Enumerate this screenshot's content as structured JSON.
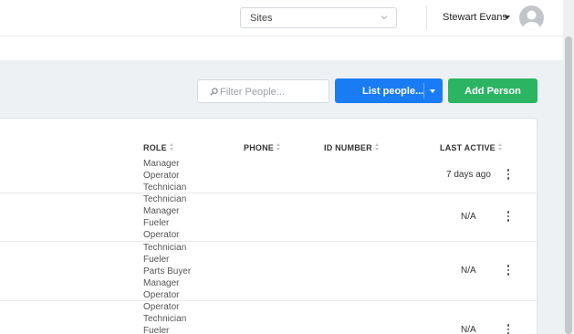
{
  "header": {
    "sites_select": {
      "value": "Sites"
    },
    "user": {
      "name": "Stewart Evans"
    }
  },
  "toolbar": {
    "filter_placeholder": "Filter People...",
    "list_people_label": "List people...",
    "add_person_label": "Add Person"
  },
  "table": {
    "columns": {
      "role": "ROLE",
      "phone": "PHONE",
      "id_number": "ID NUMBER",
      "last_active": "LAST ACTIVE"
    },
    "rows": [
      {
        "roles": [
          "Manager",
          "Operator",
          "Technician"
        ],
        "last_active": "7 days ago"
      },
      {
        "roles": [
          "Technician",
          "Manager",
          "Fueler",
          "Operator"
        ],
        "last_active": "N/A"
      },
      {
        "roles": [
          "Technician",
          "Fueler",
          "Parts Buyer",
          "Manager",
          "Operator"
        ],
        "last_active": "N/A"
      },
      {
        "roles": [
          "Operator",
          "Technician",
          "Fueler"
        ],
        "last_active": "N/A"
      }
    ]
  },
  "colors": {
    "primary": "#1a7cf4",
    "success": "#2bb563",
    "page_bg": "#eef1f4"
  },
  "icons": [
    "chevron-down-icon",
    "user-avatar-icon",
    "search-icon",
    "caret-down-icon",
    "sort-icon",
    "kebab-menu-icon"
  ]
}
